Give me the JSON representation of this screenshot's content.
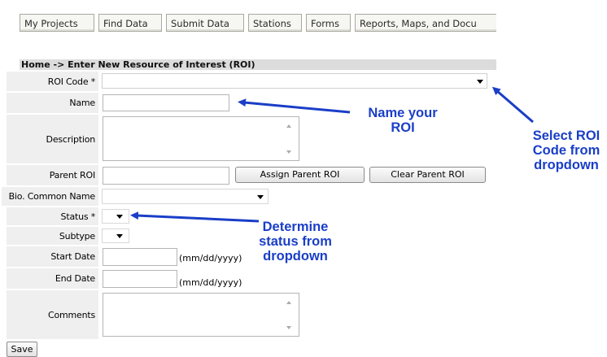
{
  "nav": {
    "items": [
      "My Projects",
      "Find Data",
      "Submit Data",
      "Stations",
      "Forms",
      "Reports, Maps, and Docu"
    ]
  },
  "breadcrumb": "Home -> Enter New Resource of Interest (ROI)",
  "form": {
    "labels": {
      "roi_code": "ROI Code *",
      "name": "Name",
      "description": "Description",
      "parent_roi": "Parent ROI",
      "bio_common_name": "Bio. Common Name",
      "status": "Status *",
      "subtype": "Subtype",
      "start_date": "Start Date",
      "end_date": "End Date",
      "comments": "Comments"
    },
    "values": {
      "roi_code": "",
      "name": "",
      "description": "",
      "parent_roi": "",
      "bio_common_name": "",
      "status": "",
      "subtype": "",
      "start_date": "",
      "end_date": "",
      "comments": ""
    },
    "date_format_hint": "(mm/dd/yyyy)",
    "buttons": {
      "assign_parent": "Assign Parent ROI",
      "clear_parent": "Clear Parent ROI",
      "save": "Save"
    }
  },
  "annotations": {
    "name_your_roi": [
      "Name your",
      "ROI"
    ],
    "select_roi_code": [
      "Select ROI",
      "Code from",
      "dropdown"
    ],
    "determine_status": [
      "Determine",
      "status from",
      "dropdown"
    ]
  },
  "colors": {
    "annotation_blue": "#1a3ec8",
    "label_bg": "#efefef",
    "breadcrumb_bg": "#dcdcdc"
  }
}
